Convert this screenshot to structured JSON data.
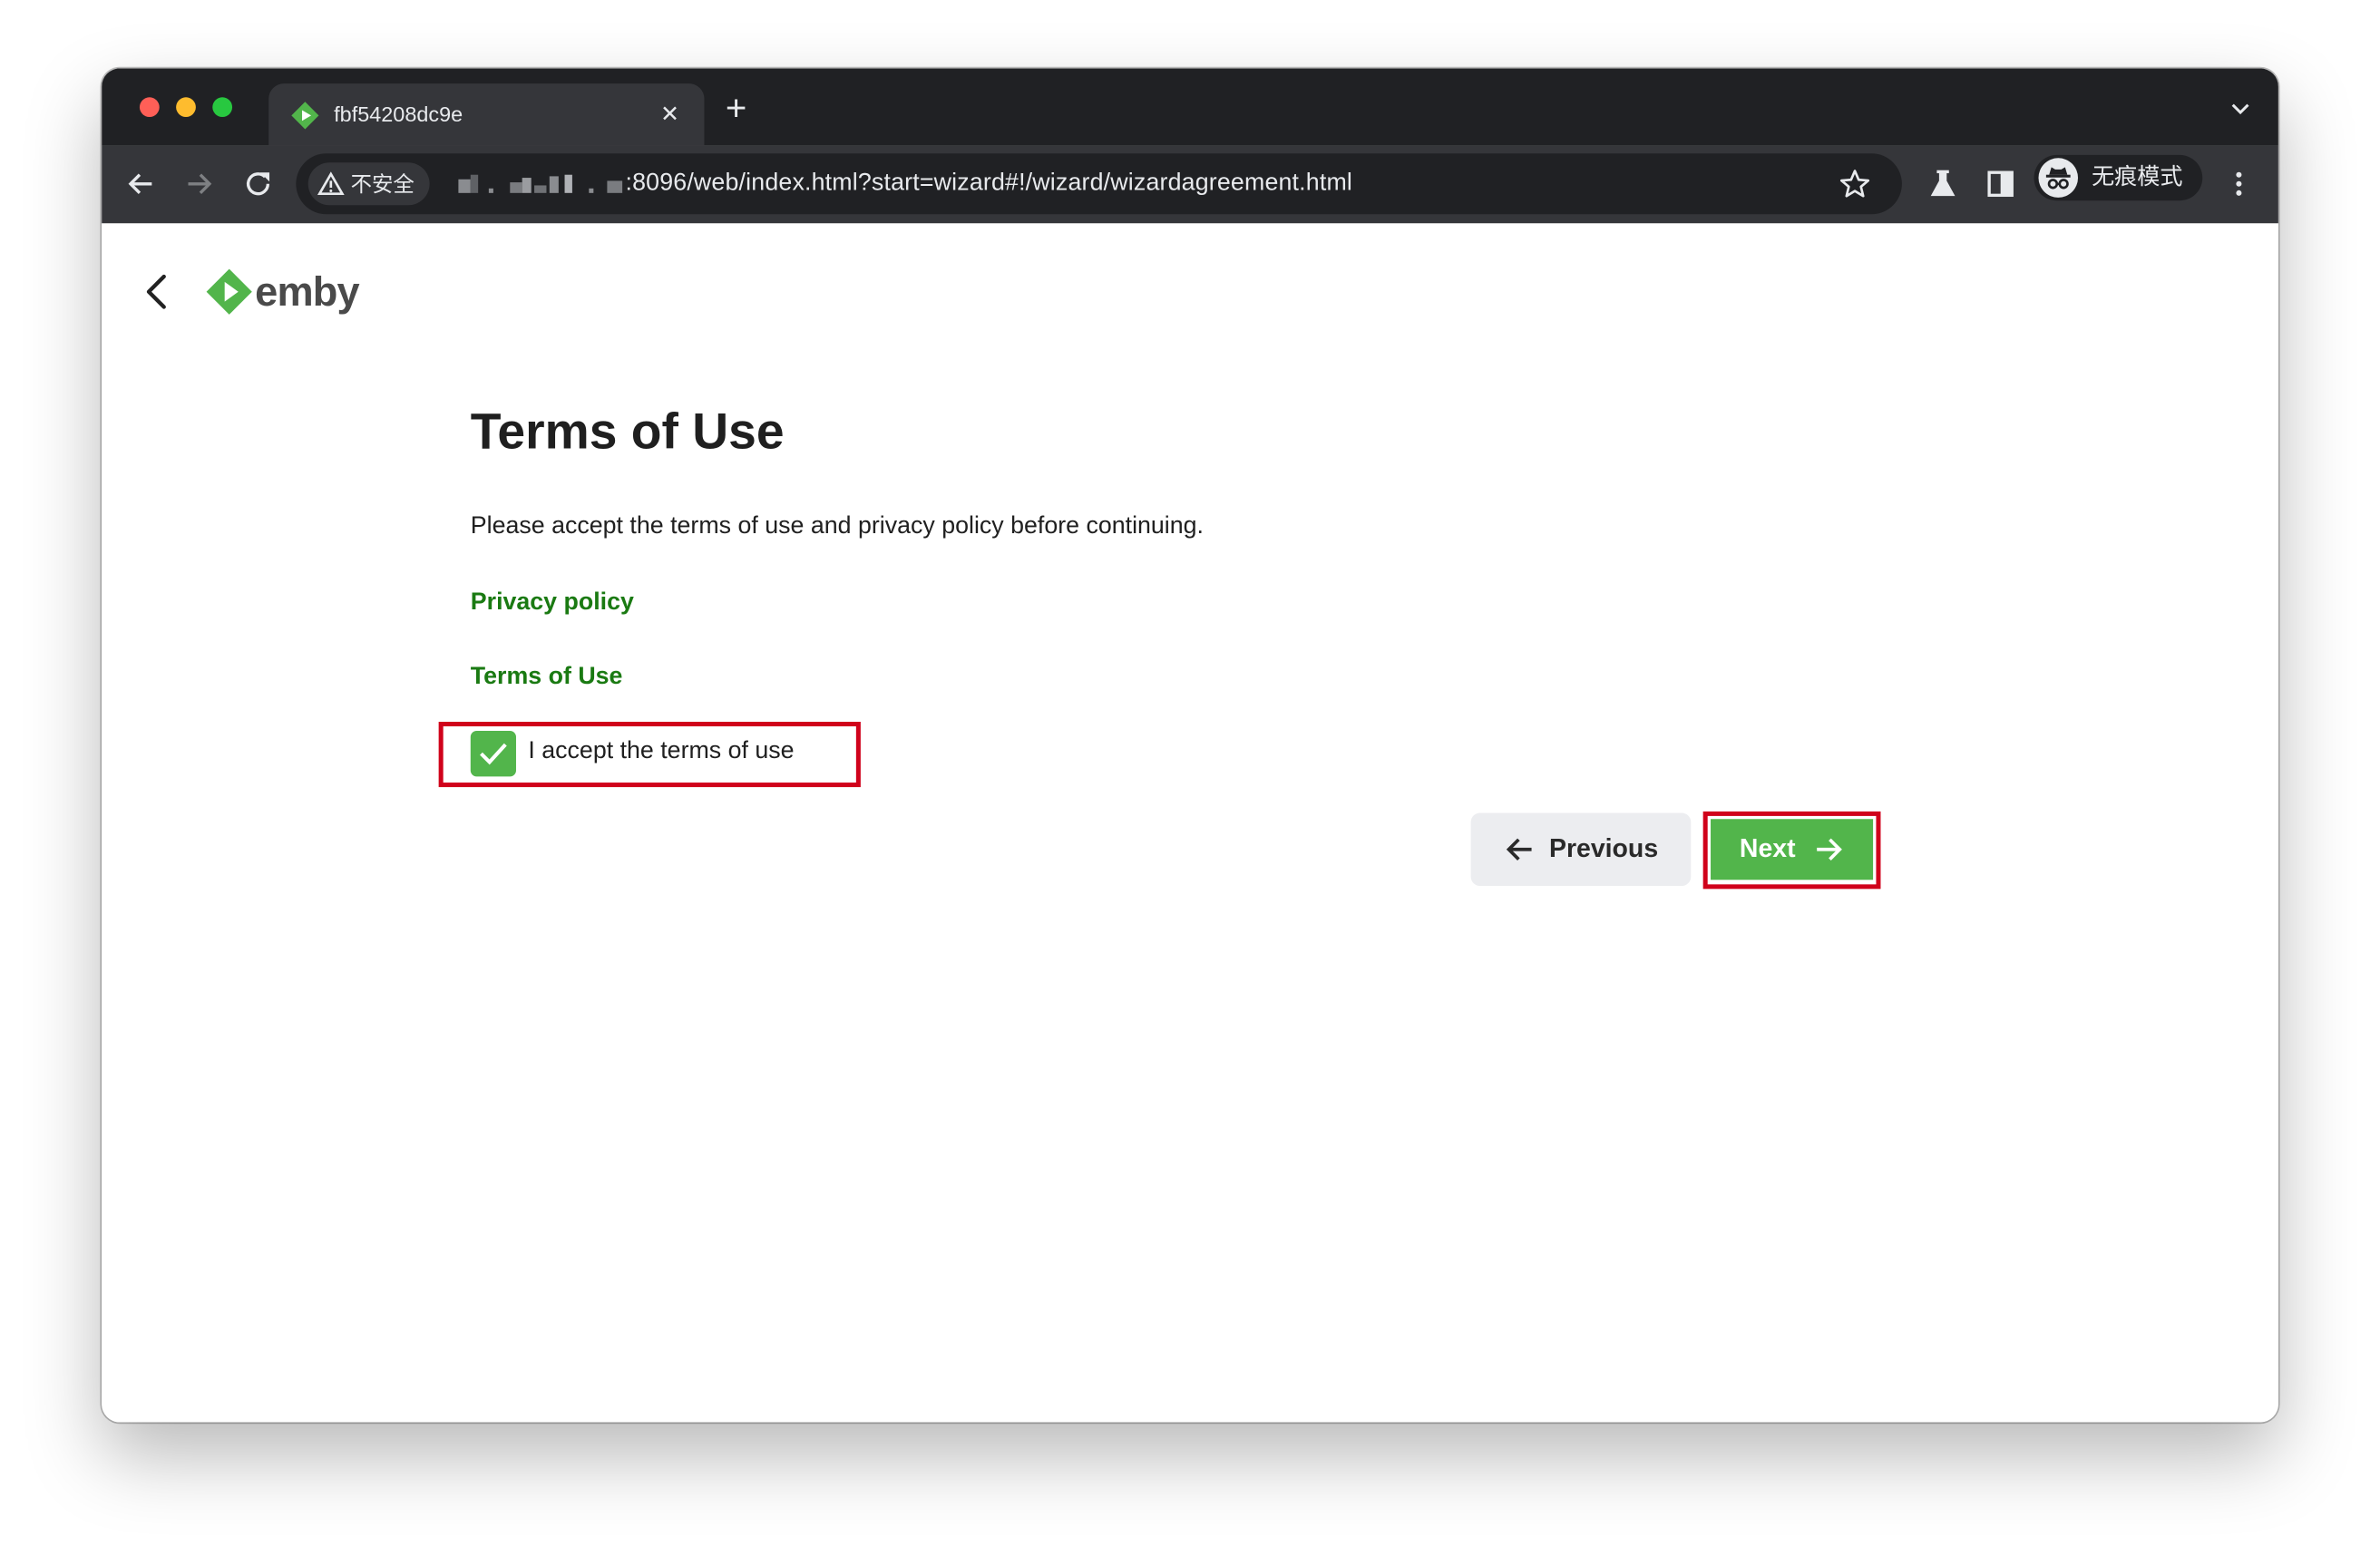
{
  "browser": {
    "tab": {
      "title": "fbf54208dc9e",
      "favicon": "emby-logo-icon",
      "close_icon": "close-icon"
    },
    "new_tab_icon": "plus-icon",
    "tab_search_icon": "chevron-down-icon",
    "toolbar": {
      "back_icon": "arrow-left-icon",
      "forward_icon": "arrow-right-icon",
      "reload_icon": "reload-icon",
      "security_label": "不安全",
      "url_suffix": ":8096/web/index.html?start=wizard#!/wizard/wizardagreement.html",
      "bookmark_icon": "star-icon",
      "labs_icon": "flask-icon",
      "side_panel_icon": "side-panel-icon",
      "profile_label": "无痕模式",
      "menu_icon": "kebab-menu-icon"
    }
  },
  "page": {
    "brand": "emby",
    "title": "Terms of Use",
    "intro": "Please accept the terms of use and privacy policy before continuing.",
    "links": {
      "privacy": "Privacy policy",
      "terms": "Terms of Use"
    },
    "accept": {
      "label": "I accept the terms of use",
      "checked": true
    },
    "buttons": {
      "previous": "Previous",
      "next": "Next"
    }
  },
  "colors": {
    "accent": "#52b54b",
    "link": "#1a7a12",
    "highlight": "#d0021b",
    "chrome_dark": "#202124",
    "chrome_toolbar": "#35363a"
  }
}
